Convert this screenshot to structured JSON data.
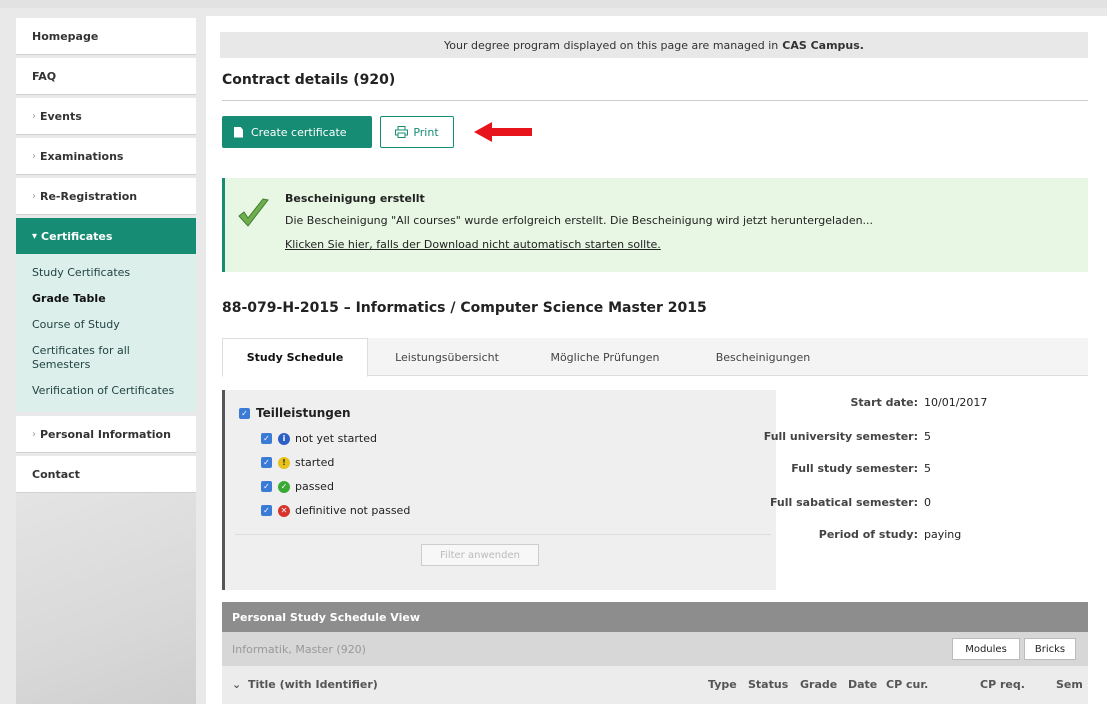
{
  "sidebar": {
    "items": [
      {
        "label": "Homepage",
        "chevron": false
      },
      {
        "label": "FAQ",
        "chevron": false
      },
      {
        "label": "Events",
        "chevron": true
      },
      {
        "label": "Examinations",
        "chevron": true
      },
      {
        "label": "Re-Registration",
        "chevron": true
      },
      {
        "label": "Certificates",
        "chevron": true,
        "active": true
      },
      {
        "label": "Personal Information",
        "chevron": true
      },
      {
        "label": "Contact",
        "chevron": false
      }
    ],
    "subitems": [
      {
        "label": "Study Certificates"
      },
      {
        "label": "Grade Table",
        "bold": true
      },
      {
        "label": "Course of Study"
      },
      {
        "label": "Certificates for all Semesters"
      },
      {
        "label": "Verification of Certificates"
      }
    ],
    "chevron_glyph": "›"
  },
  "info_bar": {
    "text": "Your degree program displayed on this page are managed in",
    "brand": "CAS Campus."
  },
  "page_title": "Contract details (920)",
  "buttons": {
    "create_certificate": "Create certificate",
    "print": "Print"
  },
  "success": {
    "heading": "Bescheinigung erstellt",
    "message": "Die Bescheinigung \"All courses\" wurde erfolgreich erstellt. Die Bescheinigung wird jetzt heruntergeladen...",
    "link": "Klicken Sie hier, falls der Download nicht automatisch starten sollte."
  },
  "program_title": "88-079-H-2015 – Informatics / Computer Science Master 2015",
  "tabs": [
    "Study Schedule",
    "Leistungsübersicht",
    "Mögliche Prüfungen",
    "Bescheinigungen"
  ],
  "filter": {
    "group_label": "Teilleistungen",
    "options": [
      {
        "label": "not yet started",
        "icon": "info-icon",
        "color": "#2d5fc4"
      },
      {
        "label": "started",
        "icon": "exclamation-icon",
        "color": "#e6c21a"
      },
      {
        "label": "passed",
        "icon": "check-icon",
        "color": "#3aaa35"
      },
      {
        "label": "definitive not passed",
        "icon": "cross-icon",
        "color": "#d9342b"
      }
    ],
    "apply_label": "Filter anwenden"
  },
  "meta": [
    {
      "key": "Start date:",
      "value": "10/01/2017"
    },
    {
      "key": "Full university semester:",
      "value": "5"
    },
    {
      "key": "Full study semester:",
      "value": "5"
    },
    {
      "key": "Full sabatical semester:",
      "value": "0"
    },
    {
      "key": "Period of study:",
      "value": "paying"
    }
  ],
  "schedule": {
    "heading": "Personal Study Schedule View",
    "sub": "Informatik, Master (920)",
    "buttons": [
      "Modules",
      "Bricks"
    ],
    "columns": [
      "Title (with Identifier)",
      "Type",
      "Status",
      "Grade",
      "Date",
      "CP cur.",
      "CP req.",
      "Sem"
    ]
  },
  "colors": {
    "accent": "#168c74",
    "arrow": "#e8141b",
    "success_bg": "#e7f7e4"
  }
}
